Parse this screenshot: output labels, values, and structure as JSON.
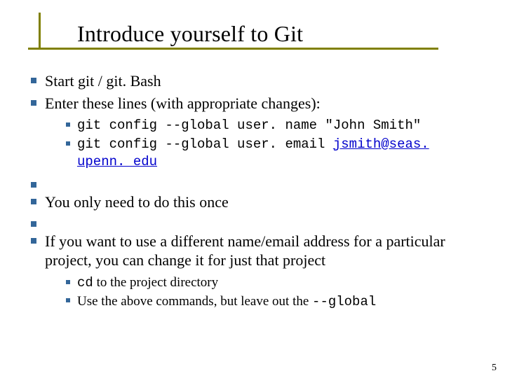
{
  "title": "Introduce yourself to Git",
  "b1": "Start git / git. Bash",
  "b2": "Enter these lines (with appropriate changes):",
  "code1_a": "git config --global user. name \"John Smith\"",
  "code2_a": "git config --global user. email ",
  "code2_link": "jsmith@seas. upenn. edu",
  "b3": "You only need to do this once",
  "b4": "If you want to use a different name/email address for a particular project, you can change it for just that project",
  "sub1_code": "cd",
  "sub1_rest": " to the project directory",
  "sub2_a": "Use the above commands, but leave out the ",
  "sub2_code": "--global",
  "pagenum": "5"
}
